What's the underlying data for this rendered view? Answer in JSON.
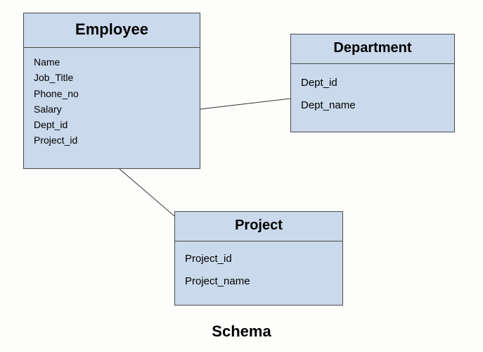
{
  "diagram_label": "Schema",
  "entities": {
    "employee": {
      "title": "Employee",
      "attributes": [
        "Name",
        "Job_Title",
        "Phone_no",
        "Salary",
        "Dept_id",
        "Project_id"
      ]
    },
    "department": {
      "title": "Department",
      "attributes": [
        "Dept_id",
        "Dept_name"
      ]
    },
    "project": {
      "title": "Project",
      "attributes": [
        "Project_id",
        "Project_name"
      ]
    }
  },
  "relationships": [
    {
      "from": "employee",
      "to": "department"
    },
    {
      "from": "employee",
      "to": "project"
    }
  ]
}
